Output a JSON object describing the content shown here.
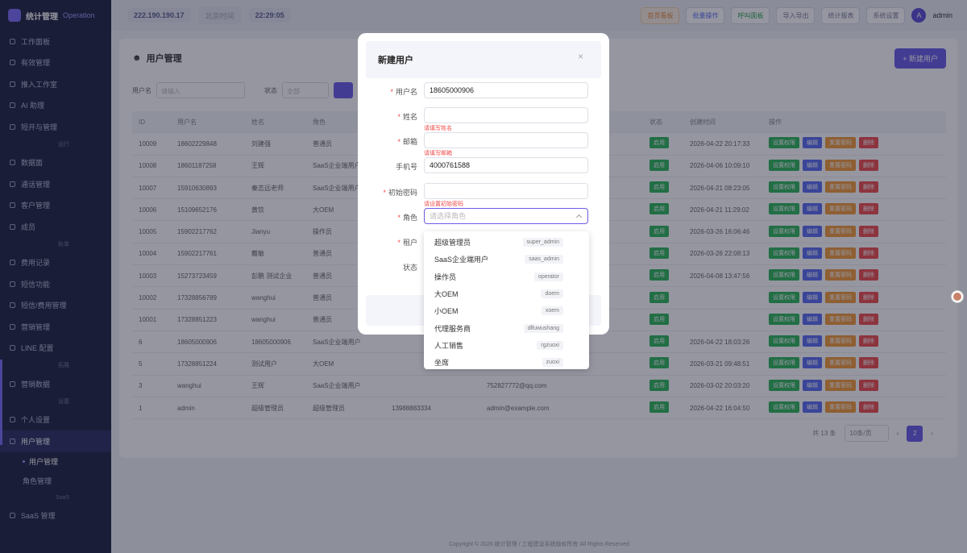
{
  "sidebar": {
    "brand_name": "统计管理",
    "brand_sub": "Operation",
    "items": [
      {
        "label": "工作面板"
      },
      {
        "label": "有效管理"
      },
      {
        "label": "推入工作室"
      },
      {
        "label": "AI 助理"
      },
      {
        "label": "短开与管理"
      }
    ],
    "group1": "运行",
    "items2": [
      {
        "label": "数据面"
      },
      {
        "label": "通话管理"
      },
      {
        "label": "客户管理"
      },
      {
        "label": "成员"
      }
    ],
    "group2": "账单",
    "items3": [
      {
        "label": "费用记录"
      },
      {
        "label": "短信功能"
      },
      {
        "label": "短信/费用管理"
      },
      {
        "label": "营销管理"
      },
      {
        "label": "LINE 配置"
      }
    ],
    "group3": "拓展",
    "items4": [
      {
        "label": "营销数据"
      }
    ],
    "group4": "设置",
    "items5": [
      {
        "label": "个人设置"
      },
      {
        "label": "用户管理"
      }
    ],
    "subs": [
      {
        "label": "用户管理"
      },
      {
        "label": "角色管理"
      }
    ],
    "group5": "SaaS",
    "items6": [
      {
        "label": "SaaS 管理"
      }
    ]
  },
  "topbar": {
    "ip": "222.190.190.17",
    "time_label": "北京时间",
    "time": "22:29:05",
    "buttons": [
      "首页看板",
      "批量操作",
      "呼叫面板",
      "导入导出",
      "统计报表",
      "系统设置"
    ],
    "user": "admin",
    "avatar_letter": "A"
  },
  "page": {
    "title": "用户管理",
    "new_button": "+ 新建用户",
    "filter_label1": "用户名",
    "filter_placeholder1": "请输入",
    "filter_label2": "状态",
    "filter_placeholder2": "全部",
    "columns": [
      "ID",
      "用户名",
      "姓名",
      "角色",
      "",
      "",
      "状态",
      "创建时间",
      "操作"
    ],
    "rows": [
      {
        "id": "10009",
        "user": "18602229848",
        "name": "刘建强",
        "role": "普通员",
        "c5": "",
        "c6": "",
        "time": "2026-04-22 20:17:33"
      },
      {
        "id": "10008",
        "user": "18601187258",
        "name": "王辉",
        "role": "SaaS企业端用户",
        "c5": "",
        "c6": "",
        "time": "2026-04-06 10:09:10"
      },
      {
        "id": "10007",
        "user": "15910630893",
        "name": "秦志远老师",
        "role": "SaaS企业端用户",
        "c5": "",
        "c6": "",
        "time": "2026-04-21 08:23:05"
      },
      {
        "id": "10006",
        "user": "15109652176",
        "name": "黄钦",
        "role": "大OEM",
        "c5": "",
        "c6": "",
        "time": "2026-04-21 11:29:02"
      },
      {
        "id": "10005",
        "user": "15902217762",
        "name": "Jianyu",
        "role": "操作员",
        "c5": "",
        "c6": "",
        "time": "2026-03-26 16:06:46"
      },
      {
        "id": "10004",
        "user": "15902217761",
        "name": "戴敏",
        "role": "普通员",
        "c5": "",
        "c6": "",
        "time": "2026-03-26 22:08:13"
      },
      {
        "id": "10003",
        "user": "15273723459",
        "name": "彭鹏 测试企业",
        "role": "普通员",
        "c5": "",
        "c6": "",
        "time": "2026-04-08 13:47:56"
      },
      {
        "id": "10002",
        "user": "17328856789",
        "name": "wanghui",
        "role": "普通员",
        "c5": "",
        "c6": "",
        "time": ""
      },
      {
        "id": "10001",
        "user": "17328851223",
        "name": "wanghui",
        "role": "普通员",
        "c5": "",
        "c6": "",
        "time": ""
      },
      {
        "id": "6",
        "user": "18605000906",
        "name": "18605000906",
        "role": "SaaS企业端用户",
        "c5": "",
        "c6": "",
        "time": "2026-04-22 18:03:26"
      },
      {
        "id": "5",
        "user": "17328851224",
        "name": "测试用户",
        "role": "大OEM",
        "c5": "",
        "c6": "",
        "time": "2026-03-21 09:48:51"
      },
      {
        "id": "3",
        "user": "wanghui",
        "name": "王辉",
        "role": "SaaS企业端用户",
        "c5": "",
        "c6": "752827772@qq.com",
        "time": "2026-03-02 20:03:20"
      },
      {
        "id": "1",
        "user": "admin",
        "name": "超级管理员",
        "role": "超级管理员",
        "c5": "13988883334",
        "c6": "admin@example.com",
        "time": "2026-04-22 16:04:50"
      }
    ],
    "status_tag": "启用",
    "ops": [
      "设置权限",
      "编辑",
      "重置密码",
      "删除"
    ],
    "pager_total": "共 13 条",
    "pager_size": "10条/页",
    "pager_current": "2",
    "footer": "Copyright © 2026 统计管理 / 工程建设系统版权所有 All Rights Reserved"
  },
  "modal": {
    "title": "新建用户",
    "close": "×",
    "fields": [
      {
        "label": "用户名",
        "required": true,
        "value": "18605000906",
        "error": ""
      },
      {
        "label": "姓名",
        "required": true,
        "value": "",
        "error": "请填写姓名"
      },
      {
        "label": "邮箱",
        "required": true,
        "value": "",
        "error": "请填写邮箱"
      },
      {
        "label": "手机号",
        "required": false,
        "value": "4000761588",
        "error": ""
      },
      {
        "label": "初始密码",
        "required": true,
        "value": "",
        "error": "请设置初始密码"
      },
      {
        "label": "角色",
        "required": true,
        "value": "",
        "placeholder": "请选择角色",
        "error": ""
      },
      {
        "label": "租户",
        "required": true,
        "value": "",
        "error": ""
      },
      {
        "label": "状态",
        "required": false,
        "value": "",
        "error": ""
      }
    ],
    "required_mark": "*"
  },
  "dropdown": {
    "options": [
      {
        "label": "超级管理员",
        "code": "super_admin"
      },
      {
        "label": "SaaS企业端用户",
        "code": "saas_admin"
      },
      {
        "label": "操作员",
        "code": "operator"
      },
      {
        "label": "大OEM",
        "code": "doem"
      },
      {
        "label": "小OEM",
        "code": "xoem"
      },
      {
        "label": "代理服务商",
        "code": "dlfuwushang"
      },
      {
        "label": "人工销售",
        "code": "rgzuoxi"
      },
      {
        "label": "坐席",
        "code": "zuoxi"
      }
    ]
  },
  "colors": {
    "accent": "#6b5ce7",
    "sidebar": "#1f2340",
    "error": "#f04a4a",
    "success": "#2fb65a"
  }
}
